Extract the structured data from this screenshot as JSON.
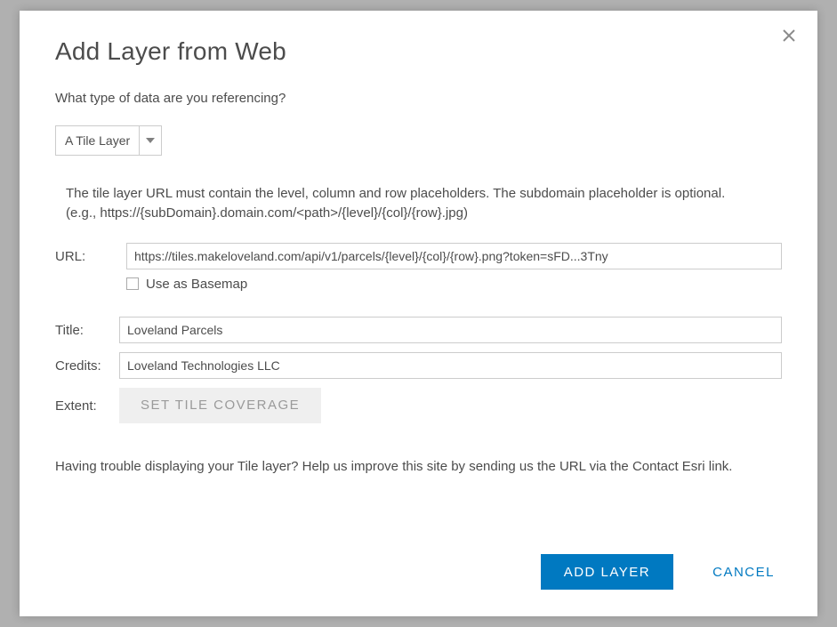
{
  "modal": {
    "title": "Add Layer from Web",
    "prompt": "What type of data are you referencing?",
    "layer_type_selected": "A Tile Layer",
    "description_line1": "The tile layer URL must contain the level, column and row placeholders. The subdomain placeholder is optional.",
    "description_line2": "(e.g., https://{subDomain}.domain.com/<path>/{level}/{col}/{row}.jpg)",
    "url_label": "URL:",
    "url_value": "https://tiles.makeloveland.com/api/v1/parcels/{level}/{col}/{row}.png?token=sFD...3Tny",
    "basemap_checkbox_label": "Use as Basemap",
    "basemap_checked": false,
    "title_label": "Title:",
    "title_value": "Loveland Parcels",
    "credits_label": "Credits:",
    "credits_value": "Loveland Technologies LLC",
    "extent_label": "Extent:",
    "coverage_button": "SET TILE COVERAGE",
    "help_text": "Having trouble displaying your Tile layer? Help us improve this site by sending us the URL via the Contact Esri link.",
    "add_button": "ADD LAYER",
    "cancel_button": "CANCEL"
  }
}
